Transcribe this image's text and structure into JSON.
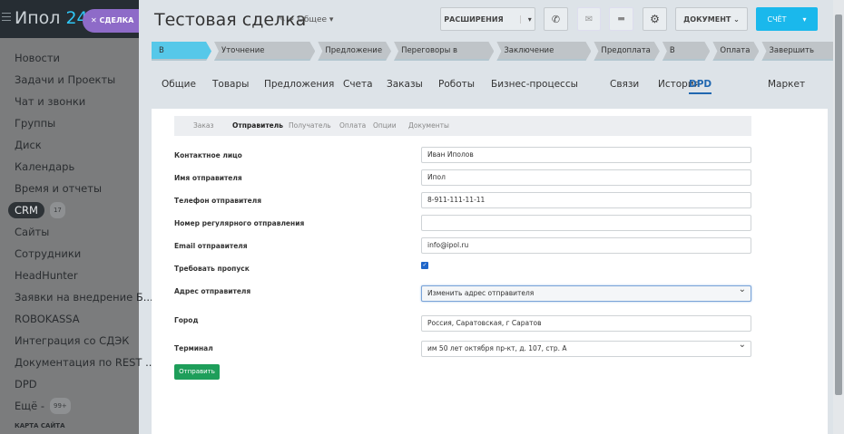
{
  "sidebar": {
    "logo_main": "Ипол",
    "logo_num": "24",
    "deal_chip": "СДЕЛКА",
    "items": [
      {
        "label": "Новости"
      },
      {
        "label": "Задачи и Проекты"
      },
      {
        "label": "Чат и звонки"
      },
      {
        "label": "Группы"
      },
      {
        "label": "Диск"
      },
      {
        "label": "Календарь"
      },
      {
        "label": "Время и отчеты"
      },
      {
        "label": "CRM",
        "badge": "17"
      },
      {
        "label": "Сайты"
      },
      {
        "label": "Сотрудники"
      },
      {
        "label": "HeadHunter"
      },
      {
        "label": "Заявки на внедрение Б..."
      },
      {
        "label": "ROBOKASSA"
      },
      {
        "label": "Интеграция со СДЭК"
      },
      {
        "label": "Документация по REST ..."
      },
      {
        "label": "DPD"
      },
      {
        "label": "Ещё -",
        "badge": "99+"
      }
    ],
    "site_map": "КАРТА САЙТА"
  },
  "header": {
    "title": "Тестовая  сделка",
    "category": "Общее",
    "extensions": "РАСШИРЕНИЯ",
    "document": "ДОКУМЕНТ",
    "invoice": "СЧЁТ"
  },
  "stages": [
    "В обработке",
    "Уточнение информации",
    "Предложение",
    "Переговоры в процессе",
    "Заключение договора",
    "Предоплата",
    "В работе",
    "Оплата",
    "Завершить сделку"
  ],
  "tabs": [
    "Общие",
    "Товары",
    "Предложения",
    "Счета",
    "Заказы",
    "Роботы",
    "Бизнес-процессы",
    "Связи",
    "История",
    "DPD",
    "Маркет"
  ],
  "subtabs": [
    "Заказ",
    "Отправитель",
    "Получатель",
    "Оплата",
    "Опции",
    "Документы"
  ],
  "form": {
    "contact_label": "Контактное лицо",
    "contact_value": "Иван Иполов",
    "name_label": "Имя отправителя",
    "name_value": "Ипол",
    "phone_label": "Телефон отправителя",
    "phone_value": "8-911-111-11-11",
    "regular_label": "Номер регулярного отправления",
    "regular_value": "",
    "email_label": "Email отправителя",
    "email_value": "info@ipol.ru",
    "pass_label": "Требовать пропуск",
    "pass_checked": true,
    "address_label": "Адрес отправителя",
    "address_value": "Изменить адрес отправителя",
    "city_label": "Город",
    "city_value": "Россия, Саратовская, г Саратов",
    "terminal_label": "Терминал",
    "terminal_value": "им 50 лет октября пр-кт, д. 107, стр. А",
    "submit": "Отправить"
  },
  "colors": {
    "accent": "#2fc6f6",
    "active_stage": "#56c8e9",
    "submit": "#1e9e5a",
    "deal_chip": "#8e6bc8"
  }
}
